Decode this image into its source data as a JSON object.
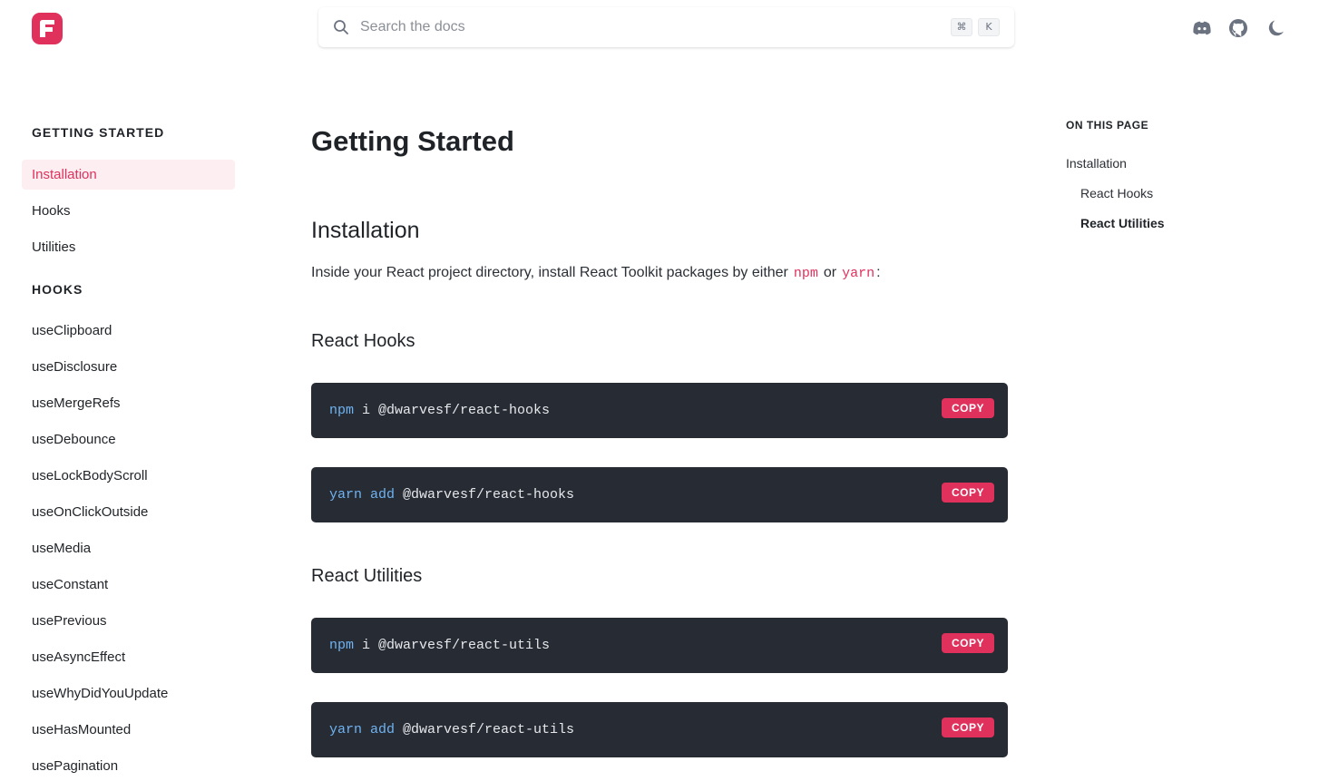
{
  "header": {
    "search_placeholder": "Search the docs",
    "shortcut_keys": [
      "⌘",
      "K"
    ],
    "icons": [
      "discord-icon",
      "github-icon",
      "moon-icon"
    ]
  },
  "colors": {
    "brand": "#e0315c",
    "code_bg": "#272b33",
    "active_bg": "#fdeef1"
  },
  "sidebar": {
    "sections": [
      {
        "title": "GETTING STARTED",
        "items": [
          "Installation",
          "Hooks",
          "Utilities"
        ],
        "active": "Installation"
      },
      {
        "title": "HOOKS",
        "items": [
          "useClipboard",
          "useDisclosure",
          "useMergeRefs",
          "useDebounce",
          "useLockBodyScroll",
          "useOnClickOutside",
          "useMedia",
          "useConstant",
          "usePrevious",
          "useAsyncEffect",
          "useWhyDidYouUpdate",
          "useHasMounted",
          "usePagination"
        ]
      }
    ]
  },
  "main": {
    "title": "Getting Started",
    "install_heading": "Installation",
    "intro_text": "Inside your React project directory, install React Toolkit packages by either",
    "intro_npm": "npm",
    "intro_or": "or",
    "intro_yarn": "yarn",
    "intro_end": ":",
    "sections": [
      {
        "heading": "React Hooks",
        "blocks": [
          {
            "cmd": "npm",
            "rest": " i @dwarvesf/react-hooks"
          },
          {
            "cmd": "yarn add",
            "rest": " @dwarvesf/react-hooks"
          }
        ]
      },
      {
        "heading": "React Utilities",
        "blocks": [
          {
            "cmd": "npm",
            "rest": " i @dwarvesf/react-utils"
          },
          {
            "cmd": "yarn add",
            "rest": " @dwarvesf/react-utils"
          }
        ]
      }
    ],
    "copy_label": "COPY"
  },
  "toc": {
    "title": "ON THIS PAGE",
    "items": [
      "Installation",
      "React Hooks",
      "React Utilities"
    ],
    "active": "React Utilities"
  }
}
